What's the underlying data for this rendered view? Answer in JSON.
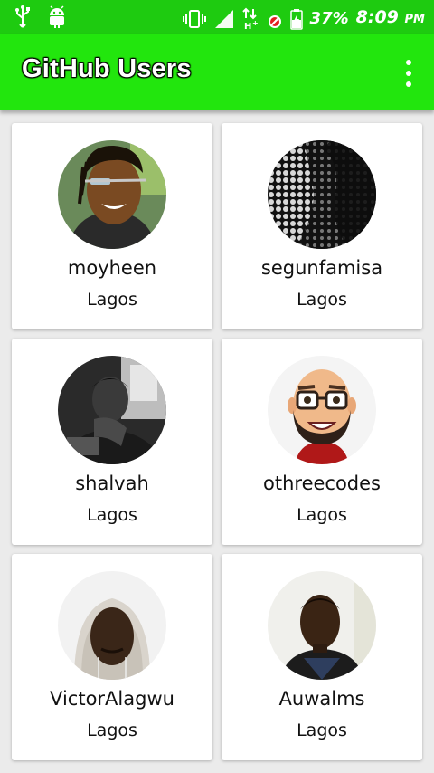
{
  "status_bar": {
    "battery": "37%",
    "time": "8:09",
    "ampm": "PM",
    "icons": [
      "usb-icon",
      "android-icon",
      "vibrate-icon",
      "signal-icon",
      "data-arrows-icon",
      "blocked-icon",
      "battery-icon"
    ]
  },
  "app_bar": {
    "title": "GitHub Users",
    "menu_icon": "overflow-menu-icon"
  },
  "users": [
    {
      "username": "moyheen",
      "location": "Lagos"
    },
    {
      "username": "segunfamisa",
      "location": "Lagos"
    },
    {
      "username": "shalvah",
      "location": "Lagos"
    },
    {
      "username": "othreecodes",
      "location": "Lagos"
    },
    {
      "username": "VictorAlagwu",
      "location": "Lagos"
    },
    {
      "username": "Auwalms",
      "location": "Lagos"
    }
  ],
  "colors": {
    "status_bar": "#1ecb10",
    "app_bar": "#22e60d",
    "background": "#ebebeb",
    "card": "#ffffff"
  }
}
